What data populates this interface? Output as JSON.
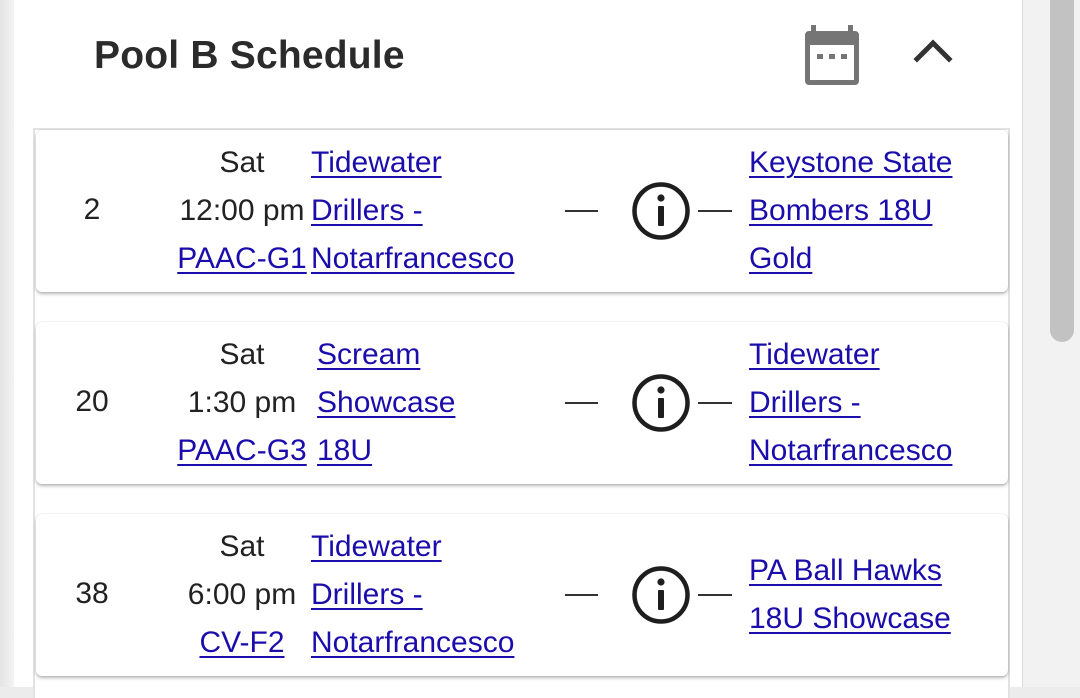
{
  "header": {
    "title": "Pool B Schedule"
  },
  "icons": {
    "calendar": "calendar-icon",
    "collapse": "chevron-up-icon",
    "info": "info-circle-icon"
  },
  "colors": {
    "link": "#1a0dab",
    "text": "#222222",
    "icon": "#757575"
  },
  "games": [
    {
      "number": "2",
      "day": "Sat",
      "time": "12:00 pm",
      "field": "PAAC-G1",
      "home_lines": [
        "Tidewater",
        "Drillers -",
        "Notarfrancesco"
      ],
      "away_lines": [
        "Keystone State",
        "Bombers 18U",
        "Gold"
      ]
    },
    {
      "number": "20",
      "day": "Sat",
      "time": "1:30 pm",
      "field": "PAAC-G3",
      "home_lines": [
        "Scream",
        "Showcase",
        "18U"
      ],
      "away_lines": [
        "Tidewater",
        "Drillers -",
        "Notarfrancesco"
      ]
    },
    {
      "number": "38",
      "day": "Sat",
      "time": "6:00 pm",
      "field": "CV-F2",
      "home_lines": [
        "Tidewater",
        "Drillers -",
        "Notarfrancesco"
      ],
      "away_lines": [
        "PA Ball Hawks",
        "18U Showcase"
      ]
    }
  ]
}
